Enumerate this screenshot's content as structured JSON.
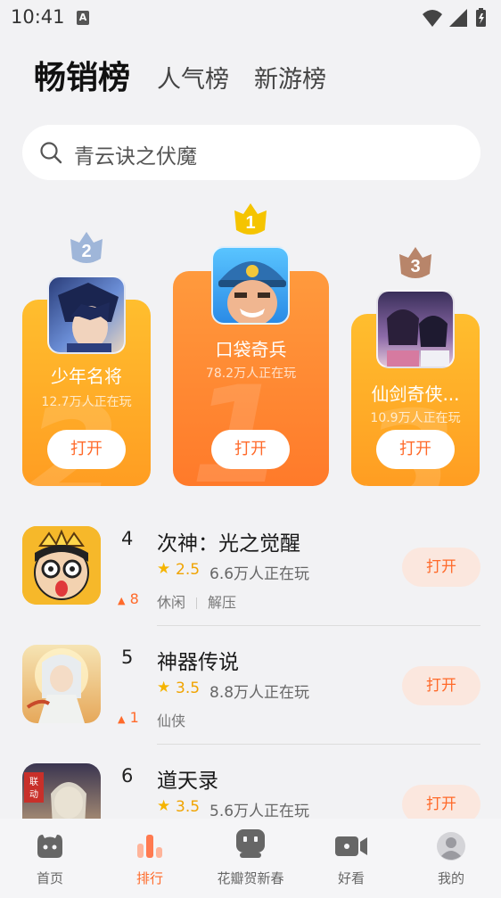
{
  "status": {
    "time": "10:41",
    "a_badge": "A"
  },
  "tabs": [
    {
      "label": "畅销榜",
      "active": true
    },
    {
      "label": "人气榜",
      "active": false
    },
    {
      "label": "新游榜",
      "active": false
    }
  ],
  "search": {
    "placeholder": "青云诀之伏魔"
  },
  "podium": [
    {
      "rank": "1",
      "name": "口袋奇兵",
      "players": "78.2万人正在玩",
      "open": "打开",
      "badge_color": "#f5c400"
    },
    {
      "rank": "2",
      "name": "少年名将",
      "players": "12.7万人正在玩",
      "open": "打开",
      "badge_color": "#9fb6d9"
    },
    {
      "rank": "3",
      "name": "仙剑奇侠...",
      "players": "10.9万人正在玩",
      "open": "打开",
      "badge_color": "#b8856a"
    }
  ],
  "list": [
    {
      "rank": "4",
      "name": "次神：光之觉醒",
      "rating": "2.5",
      "players": "6.6万人正在玩",
      "tags": [
        "休闲",
        "解压"
      ],
      "trend": "8",
      "open": "打开"
    },
    {
      "rank": "5",
      "name": "神器传说",
      "rating": "3.5",
      "players": "8.8万人正在玩",
      "tags": [
        "仙侠"
      ],
      "trend": "1",
      "open": "打开"
    },
    {
      "rank": "6",
      "name": "道天录",
      "rating": "3.5",
      "players": "5.6万人正在玩",
      "tags": [],
      "trend": "",
      "open": "打开"
    }
  ],
  "nav": [
    {
      "label": "首页",
      "icon": "home-icon",
      "active": false
    },
    {
      "label": "排行",
      "icon": "ranking-icon",
      "active": true
    },
    {
      "label": "花瓣贺新春",
      "icon": "gamepad-icon",
      "active": false
    },
    {
      "label": "好看",
      "icon": "video-icon",
      "active": false
    },
    {
      "label": "我的",
      "icon": "profile-icon",
      "active": false
    }
  ],
  "colors": {
    "accent": "#ff6a2a",
    "gold": "#f5b400",
    "background": "#f2f2f4"
  }
}
